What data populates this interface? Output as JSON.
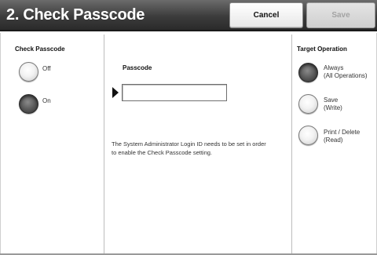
{
  "header": {
    "title": "2. Check Passcode",
    "cancel_label": "Cancel",
    "save_label": "Save"
  },
  "check_passcode": {
    "label": "Check Passcode",
    "options": [
      {
        "label": "Off",
        "selected": false
      },
      {
        "label": "On",
        "selected": true
      }
    ]
  },
  "passcode": {
    "label": "Passcode",
    "value": "",
    "note": "The System Administrator Login ID needs to be set in order to enable the Check Passcode setting."
  },
  "target_operation": {
    "label": "Target Operation",
    "options": [
      {
        "label": "Always\n(All Operations)",
        "line1": "Always",
        "line2": "(All Operations)",
        "selected": true
      },
      {
        "label": "Save\n(Write)",
        "line1": "Save",
        "line2": "(Write)",
        "selected": false
      },
      {
        "label": "Print / Delete\n(Read)",
        "line1": "Print / Delete",
        "line2": "(Read)",
        "selected": false
      }
    ]
  },
  "colors": {
    "titlebar": "#3c3c3c",
    "title_text": "#ffffff",
    "save_disabled_text": "#a3a3a3"
  }
}
